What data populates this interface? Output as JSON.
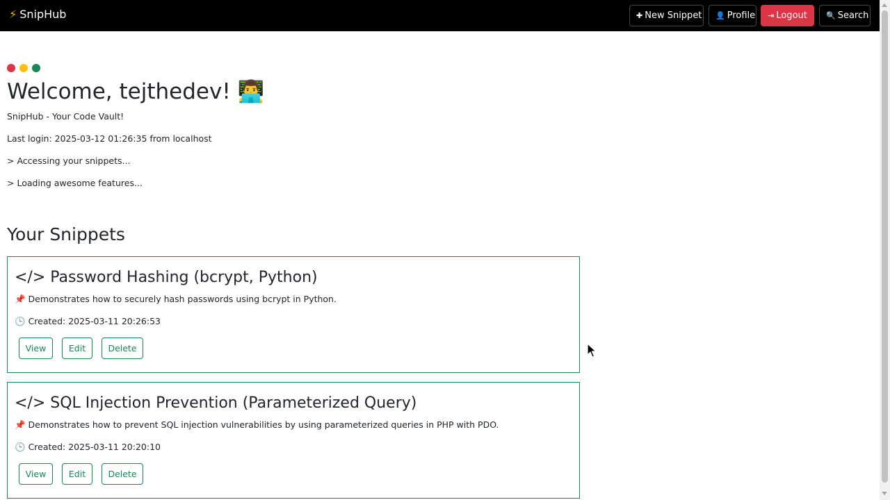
{
  "navbar": {
    "brand_icon": "⚡",
    "brand": "SnipHub",
    "buttons": {
      "new_snippet": {
        "icon": "plus-icon",
        "glyph": "✚",
        "label": "New Snippet"
      },
      "profile": {
        "icon": "user-icon",
        "glyph": "👤",
        "label": "Profile"
      },
      "logout": {
        "icon": "sign-out-icon",
        "glyph": "⇥",
        "label": "Logout"
      },
      "search": {
        "icon": "search-icon",
        "glyph": "🔍",
        "label": "Search"
      }
    }
  },
  "window_dots": {
    "colors": [
      "#dc3545",
      "#ffc107",
      "#198754"
    ]
  },
  "welcome": {
    "title": "Welcome, tejthedev! 👨‍💻",
    "tagline": "SnipHub - Your Code Vault!",
    "last_login": "Last login: 2025-03-12 01:26:35 from localhost",
    "line1": "> Accessing your snippets...",
    "line2": "> Loading awesome features..."
  },
  "snippets_section": {
    "title": "Your Snippets",
    "items": [
      {
        "title": "</> Password Hashing (bcrypt, Python)",
        "description": "📌 Demonstrates how to securely hash passwords using bcrypt in Python.",
        "created_icon": "🕒",
        "created": "Created: 2025-03-11 20:26:53",
        "actions": {
          "view": "View",
          "edit": "Edit",
          "delete": "Delete"
        }
      },
      {
        "title": "</> SQL Injection Prevention (Parameterized Query)",
        "description": "📌 Demonstrates how to prevent SQL injection vulnerabilities by using parameterized queries in PHP with PDO.",
        "created_icon": "🕒",
        "created": "Created: 2025-03-11 20:20:10",
        "actions": {
          "view": "View",
          "edit": "Edit",
          "delete": "Delete"
        }
      }
    ]
  },
  "colors": {
    "navbar_bg": "#000000",
    "accent": "#198754",
    "danger": "#dc3545"
  }
}
